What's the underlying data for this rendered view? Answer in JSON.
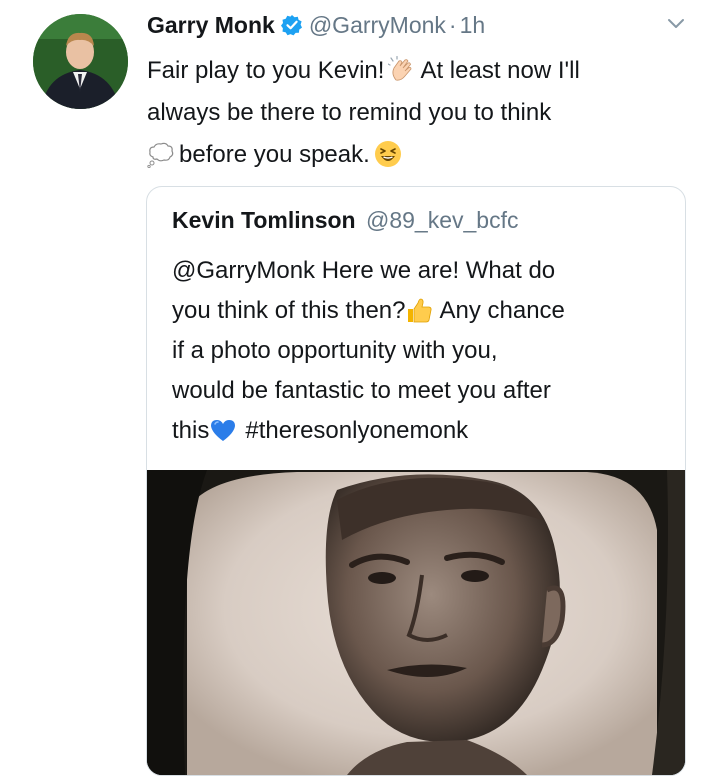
{
  "tweet": {
    "author_name": "Garry Monk",
    "handle": "@GarryMonk",
    "separator": "·",
    "time": "1h",
    "text_lines": [
      [
        "Fair play to you Kevin!",
        "clapping-hands-emoji",
        "At least now I'll"
      ],
      [
        "always be there to remind you to think"
      ],
      [
        "thought-balloon-emoji",
        "before you speak.",
        "laughing-face-emoji"
      ]
    ],
    "line1_a": "Fair play to you Kevin!",
    "line1_b": "At least now I'll",
    "line2": "always be there to remind you to think",
    "line3": "before you speak."
  },
  "quote": {
    "author_name": "Kevin Tomlinson",
    "handle": "@89_kev_bcfc",
    "line1": "@GarryMonk Here we are! What do",
    "line2_a": "you think of this then?",
    "line2_b": "Any chance",
    "line3": "if a photo opportunity with you,",
    "line4": "would be fantastic to meet you after",
    "line5_a": "this",
    "line5_b": "#theresonlyonemonk"
  },
  "icons": {
    "verified": "verified-badge-icon",
    "chevron": "chevron-down-icon",
    "clap": "clapping-hands-emoji",
    "thought": "thought-balloon-emoji",
    "laugh": "laughing-face-emoji",
    "thumbs": "thumbs-up-emoji",
    "heart": "blue-heart-emoji"
  },
  "colors": {
    "verified_blue": "#1da1f2",
    "secondary_text": "#657786",
    "border": "#d8dfe4",
    "hashtag_text": "#14171a"
  }
}
